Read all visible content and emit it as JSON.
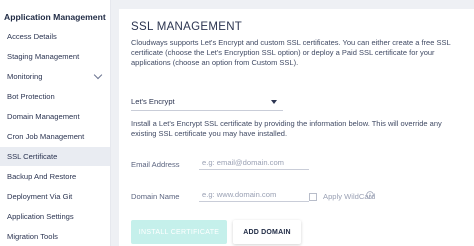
{
  "sidebar": {
    "title": "Application Management",
    "items": [
      {
        "label": "Access Details"
      },
      {
        "label": "Staging Management"
      },
      {
        "label": "Monitoring"
      },
      {
        "label": "Bot Protection"
      },
      {
        "label": "Domain Management"
      },
      {
        "label": "Cron Job Management"
      },
      {
        "label": "SSL Certificate",
        "active": true
      },
      {
        "label": "Backup And Restore"
      },
      {
        "label": "Deployment Via Git"
      },
      {
        "label": "Application Settings"
      },
      {
        "label": "Migration Tools"
      }
    ]
  },
  "main": {
    "title": "SSL MANAGEMENT",
    "description": "Cloudways supports Let's Encrypt and custom SSL certificates. You can either create a free SSL certificate (choose the Let's Encryption SSL option) or deploy a Paid SSL certificate for your applications (choose an option from Custom SSL).",
    "ssl_type": {
      "value": "Let's Encrypt"
    },
    "instructions": "Install a Let's Encrypt SSL certificate by providing the information below. This will override any existing SSL certificate you may have installed.",
    "email": {
      "label": "Email Address",
      "placeholder": "e.g: email@domain.com",
      "value": ""
    },
    "domain": {
      "label": "Domain Name",
      "placeholder": "e.g: www.domain.com",
      "value": ""
    },
    "wildcard": {
      "label": "Apply WildCard",
      "checked": false
    },
    "buttons": {
      "install": "INSTALL CERTIFICATE",
      "add_domain": "ADD DOMAIN"
    }
  },
  "colors": {
    "install_button_bg": "#c5f0eb",
    "active_item_bg": "#e9ecf2",
    "text_dark": "#1f2a44"
  }
}
